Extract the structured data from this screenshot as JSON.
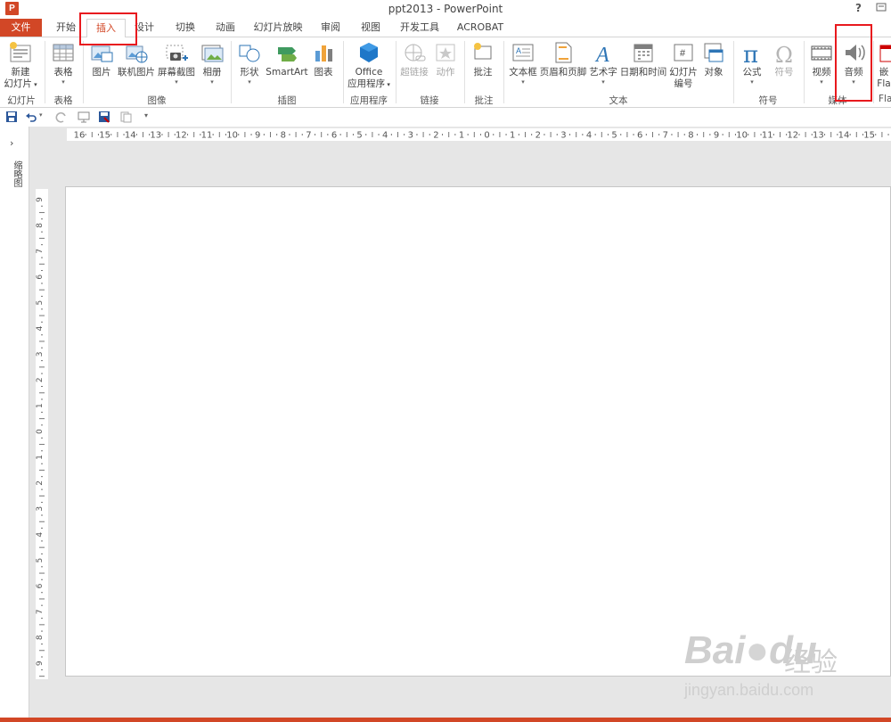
{
  "window": {
    "title": "ppt2013 - PowerPoint",
    "app_logo": "P",
    "help": "?"
  },
  "tabs": [
    {
      "label": "文件",
      "active": false
    },
    {
      "label": "开始",
      "active": false
    },
    {
      "label": "插入",
      "active": true
    },
    {
      "label": "设计",
      "active": false
    },
    {
      "label": "切换",
      "active": false
    },
    {
      "label": "动画",
      "active": false
    },
    {
      "label": "幻灯片放映",
      "active": false
    },
    {
      "label": "审阅",
      "active": false
    },
    {
      "label": "视图",
      "active": false
    },
    {
      "label": "开发工具",
      "active": false
    },
    {
      "label": "ACROBAT",
      "active": false
    }
  ],
  "ribbon": {
    "groups": {
      "slides": "幻灯片",
      "tables": "表格",
      "images": "图像",
      "illustrations": "插图",
      "apps": "应用程序",
      "links": "链接",
      "comments": "批注",
      "text": "文本",
      "symbols": "符号",
      "media": "媒体",
      "flash_clip": "Fla"
    },
    "buttons": {
      "new_slide_1": "新建",
      "new_slide_2": "幻灯片",
      "table": "表格",
      "picture": "图片",
      "online_pictures": "联机图片",
      "screenshot": "屏幕截图",
      "photo_album": "相册",
      "shapes": "形状",
      "smartart": "SmartArt",
      "chart": "图表",
      "office_apps_1": "Office",
      "office_apps_2": "应用程序",
      "hyperlink": "超链接",
      "action": "动作",
      "comment": "批注",
      "text_box": "文本框",
      "header_footer": "页眉和页脚",
      "wordart": "艺术字",
      "date_time": "日期和时间",
      "slide_number_1": "幻灯片",
      "slide_number_2": "编号",
      "object": "对象",
      "equation": "公式",
      "symbol": "符号",
      "video": "视频",
      "audio": "音频",
      "embed_flash_1": "嵌",
      "embed_flash_2": "Fla"
    }
  },
  "left_pane": {
    "arrow": "›",
    "label": "缩略图"
  },
  "ruler": {
    "horizontal": [
      "16",
      "15",
      "14",
      "13",
      "12",
      "11",
      "10",
      "9",
      "8",
      "7",
      "6",
      "5",
      "4",
      "3",
      "2",
      "1",
      "0",
      "1",
      "2",
      "3",
      "4",
      "5",
      "6",
      "7",
      "8",
      "9",
      "10",
      "11",
      "12",
      "13",
      "14",
      "15"
    ],
    "vertical": [
      "9",
      "8",
      "7",
      "6",
      "5",
      "4",
      "3",
      "2",
      "1",
      "0",
      "1",
      "2",
      "3",
      "4",
      "5",
      "6",
      "7",
      "8",
      "9"
    ]
  },
  "watermark": {
    "brand": "Bai",
    "brand2": "du",
    "cn": "经验",
    "url": "jingyan.baidu.com"
  },
  "colors": {
    "accent": "#d24726",
    "highlight": "#e8191e",
    "icon_blue": "#2e75b6"
  }
}
